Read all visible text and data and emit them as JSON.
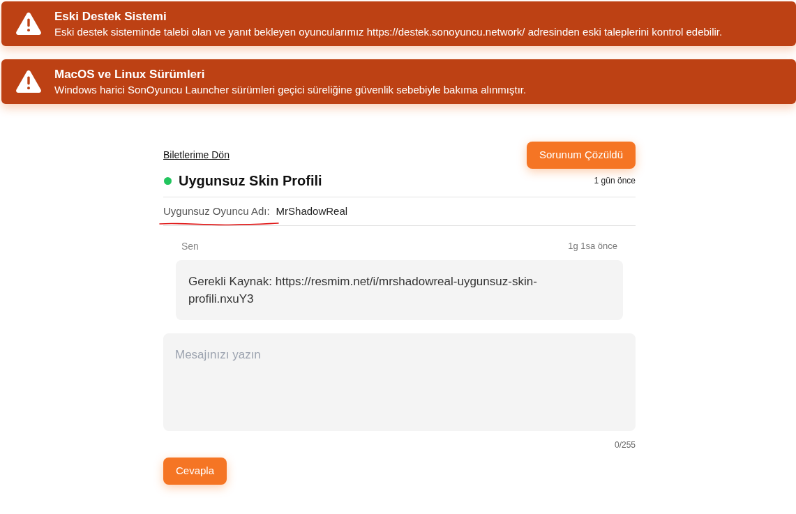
{
  "announcements": [
    {
      "title": "Eski Destek Sistemi",
      "message": "Eski destek sisteminde talebi olan ve yanıt bekleyen oyuncularımız https://destek.sonoyuncu.network/ adresinden eski taleplerini kontrol edebilir."
    },
    {
      "title": "MacOS ve Linux Sürümleri",
      "message": "Windows harici SonOyuncu Launcher sürümleri geçici süreliğine güvenlik sebebiyle bakıma alınmıştır."
    }
  ],
  "ticket": {
    "back_link": "Biletlerime Dön",
    "resolve_button": "Sorunum Çözüldü",
    "status": {
      "color": "#22c55e"
    },
    "title": "Uygunsuz Skin Profili",
    "created": "1 gün önce",
    "fields": [
      {
        "label": "Uygunsuz Oyuncu Adı:",
        "value": "MrShadowReal"
      }
    ]
  },
  "messages": [
    {
      "author": "Sen",
      "time": "1g 1sa önce",
      "text": "Gerekli Kaynak: https://resmim.net/i/mrshadowreal-uygunsuz-skin-profili.nxuY3"
    }
  ],
  "reply": {
    "placeholder": "Mesajınızı yazın",
    "counter": "0/255",
    "submit_button": "Cevapla"
  }
}
